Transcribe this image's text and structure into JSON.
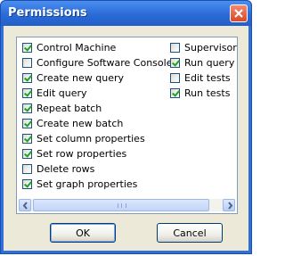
{
  "window": {
    "title": "Permissions"
  },
  "permissions": {
    "left": [
      {
        "label": "Control Machine",
        "checked": true
      },
      {
        "label": "Configure Software Console",
        "checked": false
      },
      {
        "label": "Create new query",
        "checked": true
      },
      {
        "label": "Edit query",
        "checked": true
      },
      {
        "label": "Repeat batch",
        "checked": true
      },
      {
        "label": "Create new batch",
        "checked": true
      },
      {
        "label": "Set column properties",
        "checked": true
      },
      {
        "label": "Set row properties",
        "checked": true
      },
      {
        "label": "Delete rows",
        "checked": false
      },
      {
        "label": "Set graph properties",
        "checked": true
      }
    ],
    "right": [
      {
        "label": "Supervisor",
        "checked": false
      },
      {
        "label": "Run query",
        "checked": true
      },
      {
        "label": "Edit tests",
        "checked": false
      },
      {
        "label": "Run tests",
        "checked": true
      }
    ]
  },
  "buttons": {
    "ok": "OK",
    "cancel": "Cancel"
  },
  "colors": {
    "titlebar": "#2a6bd6",
    "check": "#21a121",
    "client": "#ece9d8"
  }
}
